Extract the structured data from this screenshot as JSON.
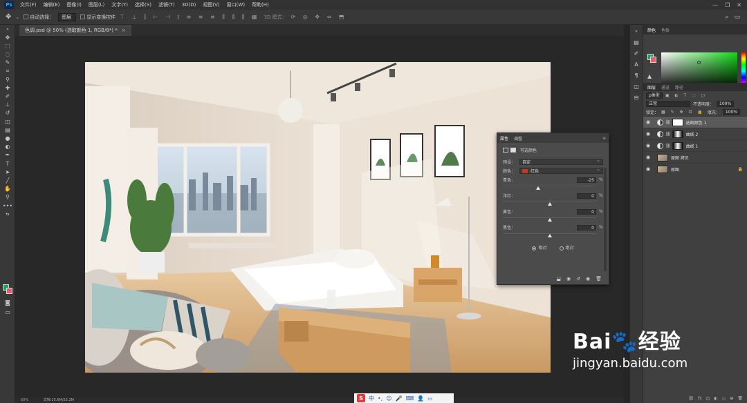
{
  "menubar": {
    "app_logo": "Ps",
    "items": [
      "文件(F)",
      "编辑(E)",
      "图像(I)",
      "图层(L)",
      "文字(Y)",
      "选择(S)",
      "滤镜(T)",
      "3D(D)",
      "视图(V)",
      "窗口(W)",
      "帮助(H)"
    ],
    "controls": [
      "—",
      "❐",
      "✕"
    ]
  },
  "options": {
    "auto_select_label": "自动选择：",
    "auto_select_value": "图层",
    "transform_label": "显示变换控件",
    "mode3d_label": "3D 模式："
  },
  "doc_tab": {
    "title": "色调.psd @ 50% (选取颜色 1, RGB/8*) *",
    "close": "×"
  },
  "status": {
    "zoom": "50%",
    "doc": "文档:15.6M/25.2M"
  },
  "properties": {
    "tab_active": "属性",
    "tab_other": "调整",
    "header": "可选颜色",
    "preset_label": "预设：",
    "preset_value": "自定",
    "color_label": "颜色：",
    "color_value": "红色",
    "color_chip": "#c0392b",
    "sliders": [
      {
        "label": "青色：",
        "value": "-25",
        "unit": "%",
        "position": 0.375
      },
      {
        "label": "洋红：",
        "value": "0",
        "unit": "%",
        "position": 0.5
      },
      {
        "label": "黄色：",
        "value": "0",
        "unit": "%",
        "position": 0.5
      },
      {
        "label": "黑色：",
        "value": "0",
        "unit": "%",
        "position": 0.5
      }
    ],
    "mode_relative": "相对",
    "mode_absolute": "绝对",
    "mode_selected": "relative"
  },
  "color_panel": {
    "tab_active": "颜色",
    "tab_other": "色板",
    "fg": "#1fa35a",
    "bg": "#e0606e"
  },
  "layers_panel": {
    "tabs": [
      "图层",
      "通道",
      "路径"
    ],
    "kind_label": "ρ类型",
    "blend_mode": "正常",
    "opacity_label": "不透明度：",
    "opacity_value": "100%",
    "lock_label": "锁定：",
    "fill_label": "填充：",
    "fill_value": "100%",
    "layers": [
      {
        "name": "选取颜色 1",
        "type": "adjustment",
        "selected": true
      },
      {
        "name": "曲线 2",
        "type": "adjustment",
        "selected": false
      },
      {
        "name": "曲线 1",
        "type": "adjustment",
        "selected": false
      },
      {
        "name": "原图 拷贝",
        "type": "image",
        "selected": false
      },
      {
        "name": "原图",
        "type": "image",
        "selected": false,
        "locked": true
      }
    ]
  },
  "ime": {
    "logo": "S",
    "label": "中"
  },
  "watermark": {
    "logo": "Bai🐾经验",
    "url": "jingyan.baidu.com"
  }
}
